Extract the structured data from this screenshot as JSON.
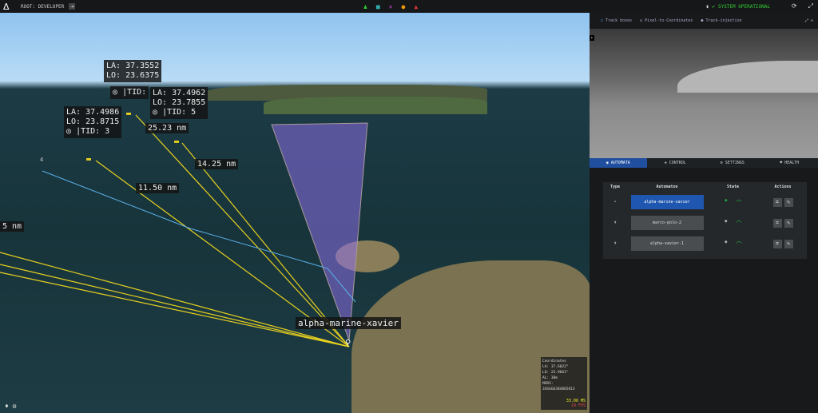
{
  "topbar": {
    "user": "ROOT: DEVELOPER",
    "status": "SYSTEM OPERATIONAL",
    "center_icons": [
      {
        "name": "person-icon",
        "color": "#3c3"
      },
      {
        "name": "vehicle-icon",
        "color": "#3aa"
      },
      {
        "name": "cross-icon",
        "color": "#c4c"
      },
      {
        "name": "robot-icon",
        "color": "#e90"
      },
      {
        "name": "rocket-icon",
        "color": "#d33"
      }
    ]
  },
  "map": {
    "tracks": [
      {
        "la": "LA: 37.3552",
        "lo": "LO: 23.6375"
      },
      {
        "la": "LA: 37.4962",
        "lo": "LO: 23.7855",
        "tid": "|TID: 5"
      },
      {
        "la": "LA: 37.4986",
        "lo": "LO: 23.8715",
        "tid": "|TID: 3"
      }
    ],
    "tid_top": "|TID:",
    "distances": [
      "25.23 nm",
      "14.25 nm",
      "11.50 nm",
      "5 nm"
    ],
    "track_num": "4",
    "vessel": "alpha-marine-xavier",
    "coords": {
      "title": "Coordinates",
      "la": "LA: 37.6022°",
      "lo": "LO: 23.9661°",
      "al": "AL: 38m",
      "mgrs_label": "MGRS:",
      "mgrs": "34SGG6384865813",
      "speed": "33.06 MS",
      "fps": "19 FPS"
    }
  },
  "panel": {
    "tools": [
      "Track boxes",
      "Pixel-to-Coordinates",
      "Track-injection"
    ],
    "tabs": [
      "AUTOMATA",
      "CONTROL",
      "SETTINGS",
      "HEALTH"
    ],
    "table": {
      "headers": [
        "Type",
        "Automaton",
        "State",
        "Actions"
      ],
      "rows": [
        {
          "name": "alpha-marine-xavier",
          "selected": true
        },
        {
          "name": "marco-polo-2"
        },
        {
          "name": "alpha-xavier-1"
        }
      ]
    }
  }
}
